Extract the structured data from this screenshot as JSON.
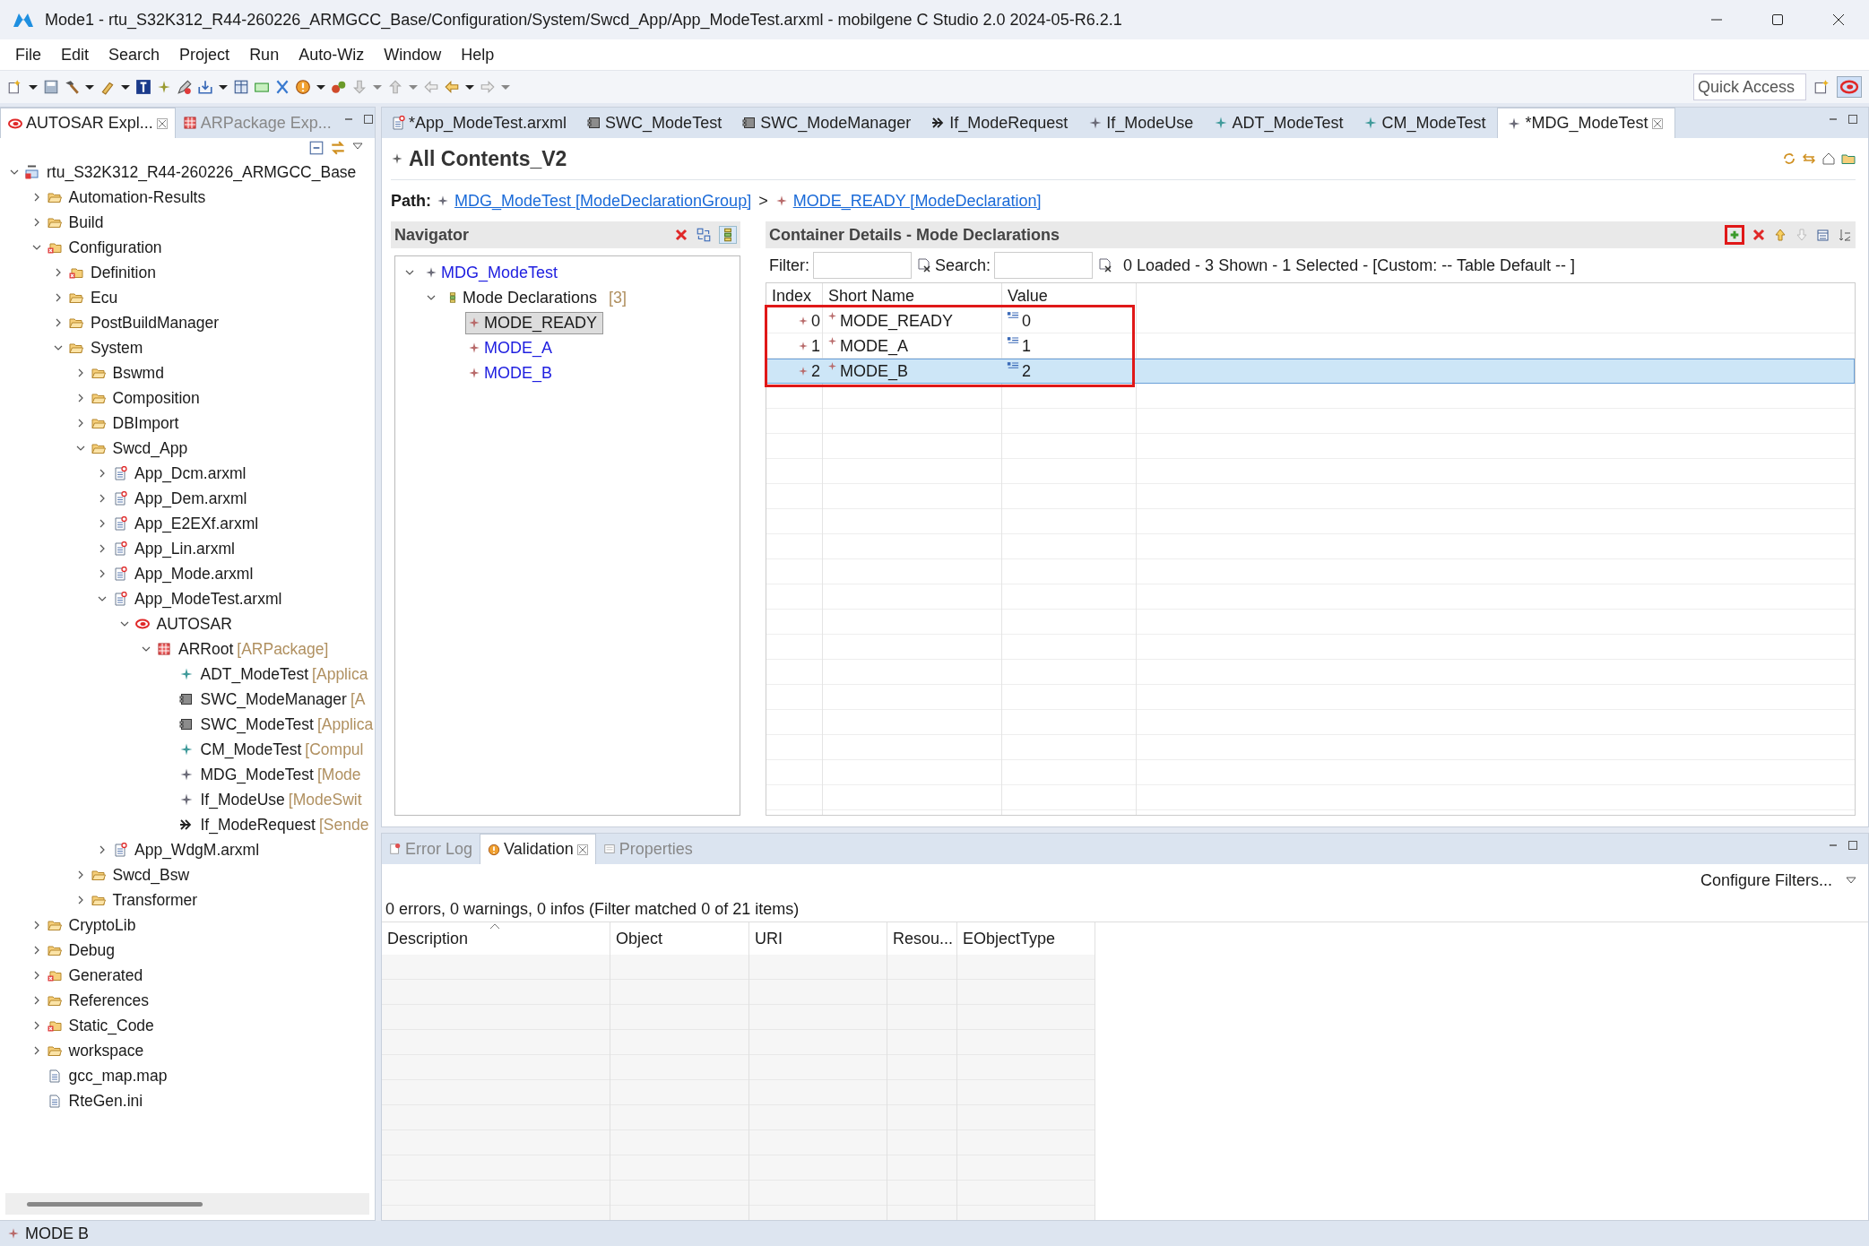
{
  "window": {
    "title": "Mode1 - rtu_S32K312_R44-260226_ARMGCC_Base/Configuration/System/Swcd_App/App_ModeTest.arxml - mobilgene C Studio 2.0 2024-05-R6.2.1"
  },
  "menu": [
    "File",
    "Edit",
    "Search",
    "Project",
    "Run",
    "Auto-Wiz",
    "Window",
    "Help"
  ],
  "quick_access": {
    "placeholder": "Quick Access"
  },
  "left_panel": {
    "tabs": [
      {
        "label": "AUTOSAR Expl...",
        "kind": "autosar",
        "selected": true
      },
      {
        "label": "ARPackage Exp...",
        "kind": "package",
        "selected": false
      }
    ],
    "tree": [
      {
        "label": "rtu_S32K312_R44-260226_ARMGCC_Base",
        "kind": "project",
        "expanded": true,
        "children": [
          {
            "label": "Automation-Results",
            "kind": "folder",
            "expanded": false
          },
          {
            "label": "Build",
            "kind": "folder",
            "expanded": false
          },
          {
            "label": "Configuration",
            "kind": "folder-error",
            "expanded": true,
            "children": [
              {
                "label": "Definition",
                "kind": "folder-error",
                "expanded": false
              },
              {
                "label": "Ecu",
                "kind": "folder",
                "expanded": false
              },
              {
                "label": "PostBuildManager",
                "kind": "folder",
                "expanded": false
              },
              {
                "label": "System",
                "kind": "folder",
                "expanded": true,
                "children": [
                  {
                    "label": "Bswmd",
                    "kind": "folder",
                    "expanded": false
                  },
                  {
                    "label": "Composition",
                    "kind": "folder",
                    "expanded": false
                  },
                  {
                    "label": "DBImport",
                    "kind": "folder",
                    "expanded": false
                  },
                  {
                    "label": "Swcd_App",
                    "kind": "folder",
                    "expanded": true,
                    "children": [
                      {
                        "label": "App_Dcm.arxml",
                        "kind": "arxml",
                        "expanded": false
                      },
                      {
                        "label": "App_Dem.arxml",
                        "kind": "arxml",
                        "expanded": false
                      },
                      {
                        "label": "App_E2EXf.arxml",
                        "kind": "arxml",
                        "expanded": false
                      },
                      {
                        "label": "App_Lin.arxml",
                        "kind": "arxml",
                        "expanded": false
                      },
                      {
                        "label": "App_Mode.arxml",
                        "kind": "arxml",
                        "expanded": false
                      },
                      {
                        "label": "App_ModeTest.arxml",
                        "kind": "arxml",
                        "expanded": true,
                        "children": [
                          {
                            "label": "AUTOSAR",
                            "kind": "autosar",
                            "expanded": true,
                            "children": [
                              {
                                "label": "ARRoot",
                                "type": "[ARPackage]",
                                "kind": "package",
                                "expanded": true,
                                "children": [
                                  {
                                    "label": "ADT_ModeTest",
                                    "type": "[Applica",
                                    "kind": "element-teal"
                                  },
                                  {
                                    "label": "SWC_ModeManager",
                                    "type": "[A",
                                    "kind": "swc"
                                  },
                                  {
                                    "label": "SWC_ModeTest",
                                    "type": "[Applica",
                                    "kind": "swc"
                                  },
                                  {
                                    "label": "CM_ModeTest",
                                    "type": "[Compul",
                                    "kind": "element-teal"
                                  },
                                  {
                                    "label": "MDG_ModeTest",
                                    "type": "[Mode",
                                    "kind": "element"
                                  },
                                  {
                                    "label": "If_ModeUse",
                                    "type": "[ModeSwit",
                                    "kind": "element"
                                  },
                                  {
                                    "label": "If_ModeRequest",
                                    "type": "[Sende",
                                    "kind": "interface"
                                  }
                                ]
                              }
                            ]
                          }
                        ]
                      },
                      {
                        "label": "App_WdgM.arxml",
                        "kind": "arxml",
                        "expanded": false
                      }
                    ]
                  },
                  {
                    "label": "Swcd_Bsw",
                    "kind": "folder",
                    "expanded": false
                  },
                  {
                    "label": "Transformer",
                    "kind": "folder",
                    "expanded": false
                  }
                ]
              }
            ]
          },
          {
            "label": "CryptoLib",
            "kind": "folder",
            "expanded": false
          },
          {
            "label": "Debug",
            "kind": "folder",
            "expanded": false
          },
          {
            "label": "Generated",
            "kind": "folder-error",
            "expanded": false
          },
          {
            "label": "References",
            "kind": "folder",
            "expanded": false
          },
          {
            "label": "Static_Code",
            "kind": "folder-error",
            "expanded": false
          },
          {
            "label": "workspace",
            "kind": "folder",
            "expanded": false
          },
          {
            "label": "gcc_map.map",
            "kind": "file"
          },
          {
            "label": "RteGen.ini",
            "kind": "file"
          }
        ]
      }
    ]
  },
  "editor_tabs": [
    {
      "label": "*App_ModeTest.arxml",
      "kind": "arxml",
      "selected": false
    },
    {
      "label": "SWC_ModeTest",
      "kind": "swc",
      "selected": false
    },
    {
      "label": "SWC_ModeManager",
      "kind": "swc",
      "selected": false
    },
    {
      "label": "If_ModeRequest",
      "kind": "interface",
      "selected": false
    },
    {
      "label": "If_ModeUse",
      "kind": "element",
      "selected": false
    },
    {
      "label": "ADT_ModeTest",
      "kind": "element-teal",
      "selected": false
    },
    {
      "label": "CM_ModeTest",
      "kind": "element-teal",
      "selected": false
    },
    {
      "label": "*MDG_ModeTest",
      "kind": "element",
      "selected": true
    }
  ],
  "editor": {
    "title": "All Contents_V2",
    "path_label": "Path:",
    "path_separator": ">",
    "path": [
      {
        "label": "MDG_ModeTest [ModeDeclarationGroup]",
        "kind": "element"
      },
      {
        "label": "MODE_READY [ModeDeclaration]",
        "kind": "mode"
      }
    ]
  },
  "navigator": {
    "title": "Navigator",
    "tree": [
      {
        "label": "MDG_ModeTest",
        "kind": "element",
        "expanded": true,
        "selected": false,
        "children": [
          {
            "label": "Mode Declarations",
            "count": "[3]",
            "kind": "list",
            "expanded": true,
            "selected": false,
            "children": [
              {
                "label": "MODE_READY",
                "kind": "mode",
                "selected": true
              },
              {
                "label": "MODE_A",
                "kind": "mode",
                "selected": false
              },
              {
                "label": "MODE_B",
                "kind": "mode",
                "selected": false
              }
            ]
          }
        ]
      }
    ]
  },
  "container": {
    "title": "Container Details - Mode Declarations",
    "add_highlighted": true,
    "filter_label": "Filter:",
    "search_label": "Search:",
    "status": "0 Loaded - 3 Shown - 1 Selected -  [Custom: -- Table Default -- ]",
    "columns": [
      "Index",
      "Short Name",
      "Value"
    ],
    "rows_framed": true,
    "rows": [
      {
        "index": "0",
        "short_name": "MODE_READY",
        "value": "0",
        "selected": false
      },
      {
        "index": "1",
        "short_name": "MODE_A",
        "value": "1",
        "selected": false
      },
      {
        "index": "2",
        "short_name": "MODE_B",
        "value": "2",
        "selected": true
      }
    ]
  },
  "bottom_panel": {
    "tabs": [
      {
        "label": "Error Log",
        "kind": "log",
        "selected": false
      },
      {
        "label": "Validation",
        "kind": "validation",
        "selected": true
      },
      {
        "label": "Properties",
        "kind": "properties",
        "selected": false
      }
    ],
    "configure_filters": "Configure Filters...",
    "summary": "0 errors, 0 warnings, 0 infos (Filter matched 0 of 21 items)",
    "columns": [
      "Description",
      "Object",
      "URI",
      "Resou...",
      "EObjectType"
    ]
  },
  "status_bar": {
    "text": "MODE B",
    "kind": "mode"
  }
}
